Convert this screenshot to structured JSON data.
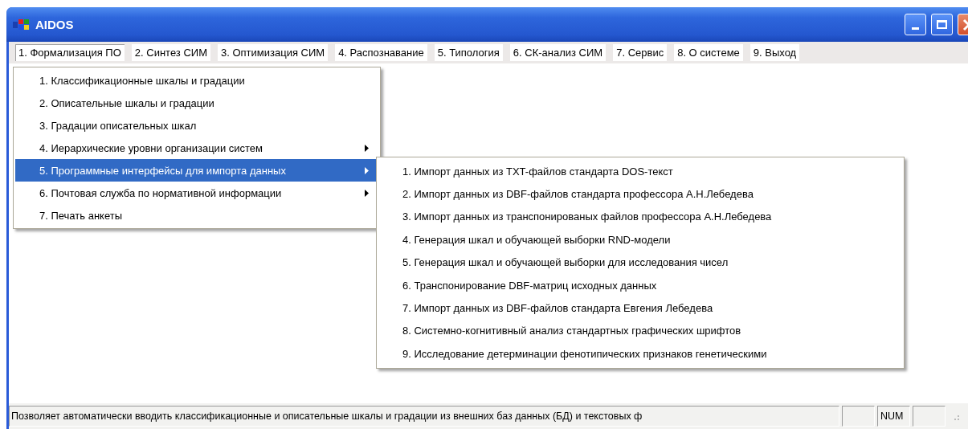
{
  "window": {
    "title": "AIDOS"
  },
  "menu_bar": [
    {
      "label": "1. Формализация ПО",
      "selected": true
    },
    {
      "label": "2. Синтез СИМ",
      "selected": false
    },
    {
      "label": "3. Оптимизация СИМ",
      "selected": false
    },
    {
      "label": "4. Распознавание",
      "selected": false
    },
    {
      "label": "5. Типология",
      "selected": false
    },
    {
      "label": "6. СК-анализ СИМ",
      "selected": false
    },
    {
      "label": "7. Сервис",
      "selected": false
    },
    {
      "label": "8. О системе",
      "selected": false
    },
    {
      "label": "9. Выход",
      "selected": false
    }
  ],
  "dropdown": [
    {
      "label": "1. Классификационные шкалы и градации",
      "selected": false,
      "has_submenu": false
    },
    {
      "label": "2. Описательные шкалы и градации",
      "selected": false,
      "has_submenu": false
    },
    {
      "label": "3. Градации описательных шкал",
      "selected": false,
      "has_submenu": false
    },
    {
      "label": "4. Иерархические уровни организации систем",
      "selected": false,
      "has_submenu": true
    },
    {
      "label": "5. Программные интерфейсы для импорта данных",
      "selected": true,
      "has_submenu": true
    },
    {
      "label": "6. Почтовая служба по нормативной информации",
      "selected": false,
      "has_submenu": true
    },
    {
      "label": "7. Печать анкеты",
      "selected": false,
      "has_submenu": false
    }
  ],
  "submenu": [
    {
      "label": "1. Импорт данных из TXT-файлов стандарта DOS-текст",
      "selected": false
    },
    {
      "label": "2. Импорт данных из  DBF-файлов стандарта профессора А.Н.Лебедева",
      "selected": false
    },
    {
      "label": "3. Импорт данных из транспонированых файлов профессора А.Н.Лебедева",
      "selected": false
    },
    {
      "label": "4. Генерация шкал и обучающей выборки RND-модели",
      "selected": false
    },
    {
      "label": "5. Генерация шкал и обучающей выборки для исследования чисел",
      "selected": false
    },
    {
      "label": "6. Транспонирование DBF-матриц исходных данных",
      "selected": false
    },
    {
      "label": "7. Импорт данных из  DBF-файлов стандарта Евгения Лебедева",
      "selected": false
    },
    {
      "label": "8. Системно-когнитивный анализ стандартных графических шрифтов",
      "selected": false
    },
    {
      "label": "9. Исследование детерминации фенотипических признаков генетическими",
      "selected": false
    }
  ],
  "status_bar": {
    "message": "Позволяет автоматически вводить классификационные и описательные шкалы и градации из внешних баз данных (БД) и текстовых ф",
    "panels": [
      {
        "kind": "blank"
      },
      {
        "kind": "text",
        "text": "NUM"
      },
      {
        "kind": "blank"
      }
    ]
  }
}
